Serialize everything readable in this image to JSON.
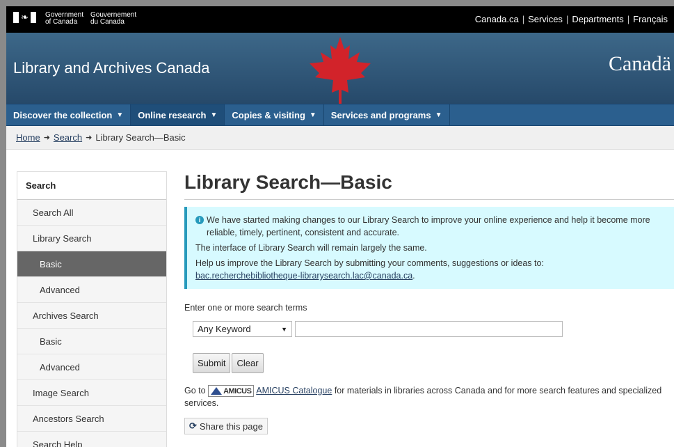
{
  "gov": {
    "name_en": "Government\nof Canada",
    "name_en_1": "Government",
    "name_en_2": "of Canada",
    "name_fr_1": "Gouvernement",
    "name_fr_2": "du Canada",
    "links": [
      "Canada.ca",
      "Services",
      "Departments",
      "Français"
    ]
  },
  "banner": {
    "site_title": "Library and Archives Canada",
    "wordmark": "Canadä"
  },
  "nav": {
    "items": [
      {
        "label": "Discover the collection"
      },
      {
        "label": "Online research"
      },
      {
        "label": "Copies & visiting"
      },
      {
        "label": "Services and programs"
      }
    ]
  },
  "breadcrumb": {
    "home": "Home",
    "search": "Search",
    "current": "Library Search—Basic"
  },
  "sidebar": {
    "heading": "Search",
    "items": [
      {
        "label": "Search All"
      },
      {
        "label": "Library Search"
      },
      {
        "label": "Basic"
      },
      {
        "label": "Advanced"
      },
      {
        "label": "Archives Search"
      },
      {
        "label": "Basic"
      },
      {
        "label": "Advanced"
      },
      {
        "label": "Image Search"
      },
      {
        "label": "Ancestors Search"
      },
      {
        "label": "Search Help"
      }
    ]
  },
  "main": {
    "title": "Library Search—Basic",
    "info": {
      "line1": "We have started making changes to our Library Search to improve your online experience and help it become more reliable, timely, pertinent, consistent and accurate.",
      "line2": "The interface of Library Search will remain largely the same.",
      "line3": "Help us improve the Library Search by submitting your comments, suggestions or ideas to:",
      "email": "bac.recherchebibliotheque-librarysearch.lac@canada.ca",
      "email_suffix": "."
    },
    "prompt": "Enter one or more search terms",
    "search": {
      "field_selected": "Any Keyword",
      "query_value": ""
    },
    "submit_label": "Submit",
    "clear_label": "Clear",
    "amicus": {
      "prefix": "Go to",
      "logo_text": "AMICUS",
      "link": "AMICUS Catalogue",
      "suffix": "for materials in libraries across Canada and for more search features and specialized services."
    },
    "share_label": "Share this page"
  }
}
